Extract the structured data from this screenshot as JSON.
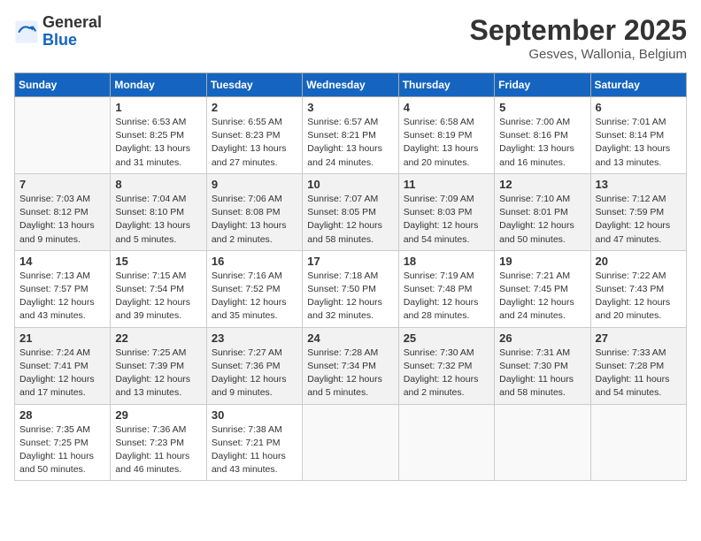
{
  "header": {
    "logo_general": "General",
    "logo_blue": "Blue",
    "month_title": "September 2025",
    "location": "Gesves, Wallonia, Belgium"
  },
  "days_of_week": [
    "Sunday",
    "Monday",
    "Tuesday",
    "Wednesday",
    "Thursday",
    "Friday",
    "Saturday"
  ],
  "weeks": [
    [
      {
        "day": "",
        "info": ""
      },
      {
        "day": "1",
        "info": "Sunrise: 6:53 AM\nSunset: 8:25 PM\nDaylight: 13 hours\nand 31 minutes."
      },
      {
        "day": "2",
        "info": "Sunrise: 6:55 AM\nSunset: 8:23 PM\nDaylight: 13 hours\nand 27 minutes."
      },
      {
        "day": "3",
        "info": "Sunrise: 6:57 AM\nSunset: 8:21 PM\nDaylight: 13 hours\nand 24 minutes."
      },
      {
        "day": "4",
        "info": "Sunrise: 6:58 AM\nSunset: 8:19 PM\nDaylight: 13 hours\nand 20 minutes."
      },
      {
        "day": "5",
        "info": "Sunrise: 7:00 AM\nSunset: 8:16 PM\nDaylight: 13 hours\nand 16 minutes."
      },
      {
        "day": "6",
        "info": "Sunrise: 7:01 AM\nSunset: 8:14 PM\nDaylight: 13 hours\nand 13 minutes."
      }
    ],
    [
      {
        "day": "7",
        "info": "Sunrise: 7:03 AM\nSunset: 8:12 PM\nDaylight: 13 hours\nand 9 minutes."
      },
      {
        "day": "8",
        "info": "Sunrise: 7:04 AM\nSunset: 8:10 PM\nDaylight: 13 hours\nand 5 minutes."
      },
      {
        "day": "9",
        "info": "Sunrise: 7:06 AM\nSunset: 8:08 PM\nDaylight: 13 hours\nand 2 minutes."
      },
      {
        "day": "10",
        "info": "Sunrise: 7:07 AM\nSunset: 8:05 PM\nDaylight: 12 hours\nand 58 minutes."
      },
      {
        "day": "11",
        "info": "Sunrise: 7:09 AM\nSunset: 8:03 PM\nDaylight: 12 hours\nand 54 minutes."
      },
      {
        "day": "12",
        "info": "Sunrise: 7:10 AM\nSunset: 8:01 PM\nDaylight: 12 hours\nand 50 minutes."
      },
      {
        "day": "13",
        "info": "Sunrise: 7:12 AM\nSunset: 7:59 PM\nDaylight: 12 hours\nand 47 minutes."
      }
    ],
    [
      {
        "day": "14",
        "info": "Sunrise: 7:13 AM\nSunset: 7:57 PM\nDaylight: 12 hours\nand 43 minutes."
      },
      {
        "day": "15",
        "info": "Sunrise: 7:15 AM\nSunset: 7:54 PM\nDaylight: 12 hours\nand 39 minutes."
      },
      {
        "day": "16",
        "info": "Sunrise: 7:16 AM\nSunset: 7:52 PM\nDaylight: 12 hours\nand 35 minutes."
      },
      {
        "day": "17",
        "info": "Sunrise: 7:18 AM\nSunset: 7:50 PM\nDaylight: 12 hours\nand 32 minutes."
      },
      {
        "day": "18",
        "info": "Sunrise: 7:19 AM\nSunset: 7:48 PM\nDaylight: 12 hours\nand 28 minutes."
      },
      {
        "day": "19",
        "info": "Sunrise: 7:21 AM\nSunset: 7:45 PM\nDaylight: 12 hours\nand 24 minutes."
      },
      {
        "day": "20",
        "info": "Sunrise: 7:22 AM\nSunset: 7:43 PM\nDaylight: 12 hours\nand 20 minutes."
      }
    ],
    [
      {
        "day": "21",
        "info": "Sunrise: 7:24 AM\nSunset: 7:41 PM\nDaylight: 12 hours\nand 17 minutes."
      },
      {
        "day": "22",
        "info": "Sunrise: 7:25 AM\nSunset: 7:39 PM\nDaylight: 12 hours\nand 13 minutes."
      },
      {
        "day": "23",
        "info": "Sunrise: 7:27 AM\nSunset: 7:36 PM\nDaylight: 12 hours\nand 9 minutes."
      },
      {
        "day": "24",
        "info": "Sunrise: 7:28 AM\nSunset: 7:34 PM\nDaylight: 12 hours\nand 5 minutes."
      },
      {
        "day": "25",
        "info": "Sunrise: 7:30 AM\nSunset: 7:32 PM\nDaylight: 12 hours\nand 2 minutes."
      },
      {
        "day": "26",
        "info": "Sunrise: 7:31 AM\nSunset: 7:30 PM\nDaylight: 11 hours\nand 58 minutes."
      },
      {
        "day": "27",
        "info": "Sunrise: 7:33 AM\nSunset: 7:28 PM\nDaylight: 11 hours\nand 54 minutes."
      }
    ],
    [
      {
        "day": "28",
        "info": "Sunrise: 7:35 AM\nSunset: 7:25 PM\nDaylight: 11 hours\nand 50 minutes."
      },
      {
        "day": "29",
        "info": "Sunrise: 7:36 AM\nSunset: 7:23 PM\nDaylight: 11 hours\nand 46 minutes."
      },
      {
        "day": "30",
        "info": "Sunrise: 7:38 AM\nSunset: 7:21 PM\nDaylight: 11 hours\nand 43 minutes."
      },
      {
        "day": "",
        "info": ""
      },
      {
        "day": "",
        "info": ""
      },
      {
        "day": "",
        "info": ""
      },
      {
        "day": "",
        "info": ""
      }
    ]
  ]
}
